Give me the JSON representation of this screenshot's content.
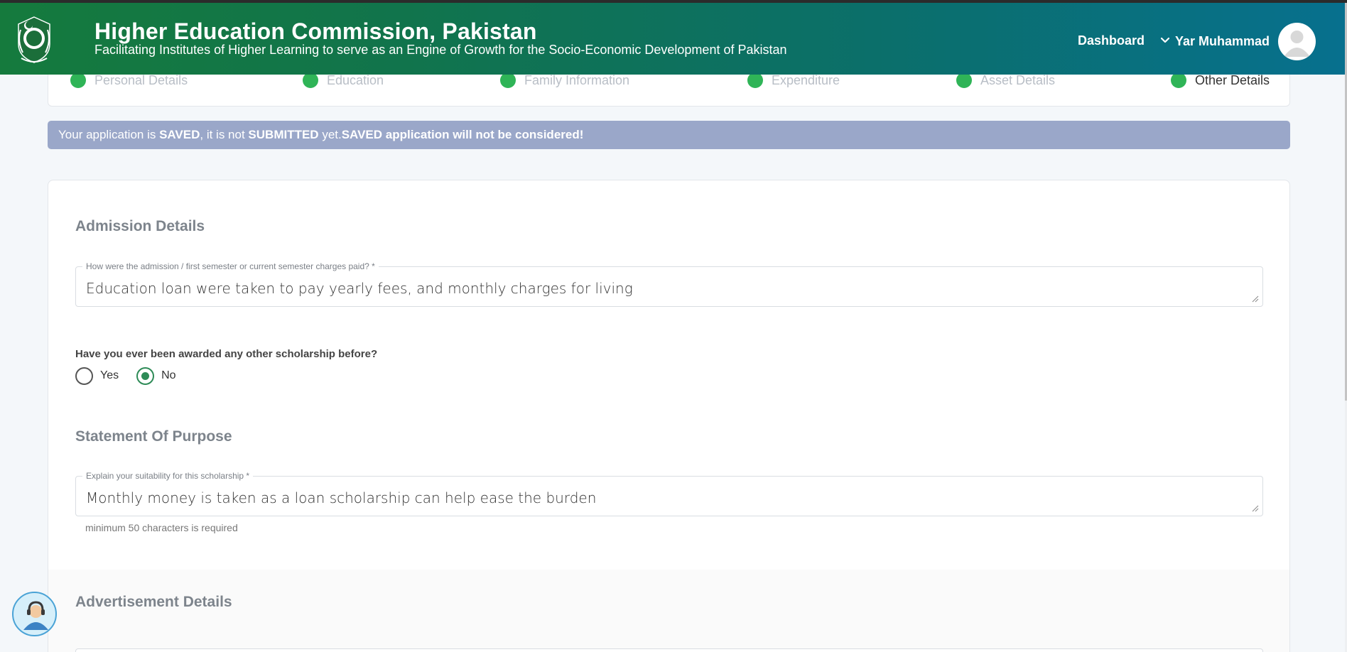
{
  "header": {
    "title": "Higher Education Commission, Pakistan",
    "subtitle": "Facilitating Institutes of Higher Learning to serve as an Engine of Growth for the Socio-Economic Development of Pakistan",
    "nav_dashboard": "Dashboard",
    "user_name": "Yar Muhammad",
    "logo_icon": "hec-logo",
    "avatar_icon": "user-avatar-icon"
  },
  "steps": [
    {
      "label": "Personal Details",
      "status": "complete"
    },
    {
      "label": "Education",
      "status": "complete"
    },
    {
      "label": "Family Information",
      "status": "complete"
    },
    {
      "label": "Expenditure",
      "status": "complete"
    },
    {
      "label": "Asset Details",
      "status": "complete"
    },
    {
      "label": "Other Details",
      "status": "current"
    }
  ],
  "alert": {
    "part1": "Your application is ",
    "saved": "SAVED",
    "part2": ", it is not ",
    "submitted": "SUBMITTED",
    "part3": " yet.",
    "warning": "SAVED application will not be considered!"
  },
  "admission": {
    "title": "Admission Details",
    "charges_label": "How were the admission / first semester or current semester charges paid? *",
    "charges_value": "Education loan were taken to pay yearly fees, and monthly charges for living",
    "scholarship_question": "Have you ever been awarded any other scholarship before?",
    "options": [
      "Yes",
      "No"
    ],
    "selected": "No"
  },
  "statement": {
    "title": "Statement Of Purpose",
    "suitability_label": "Explain your suitability for this scholarship *",
    "suitability_value": "Monthly money is taken as a loan scholarship can help ease the burden",
    "helper": "minimum 50 characters is required"
  },
  "advertisement": {
    "title": "Advertisement Details"
  },
  "support": {
    "icon": "support-agent-icon"
  },
  "colors": {
    "header_start": "#157a3d",
    "header_end": "#07708e",
    "step_check": "#2fb457",
    "alert_bg": "#9aa7c9",
    "radio_selected": "#2e8b57"
  }
}
